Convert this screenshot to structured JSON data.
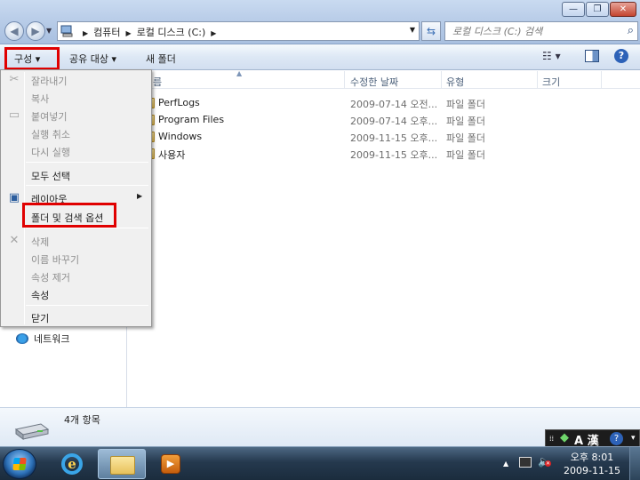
{
  "window": {
    "minimize_glyph": "—",
    "maximize_glyph": "❐",
    "close_glyph": "✕"
  },
  "address": {
    "crumbs": [
      "컴퓨터",
      "로컬 디스크 (C:)"
    ],
    "search_placeholder": "로컬 디스크 (C:) 검색"
  },
  "toolbar": {
    "organize_label": "구성 ▾",
    "share_label": "공유 대상 ▾",
    "new_folder_label": "새 폴더",
    "view_icon": "view-menu-icon",
    "help_icon": "help-icon",
    "help_glyph": "?"
  },
  "columns": {
    "name": "름",
    "date": "수정한 날짜",
    "type": "유형",
    "size": "크기"
  },
  "files": [
    {
      "name": "PerfLogs",
      "date": "2009-07-14 오전...",
      "type": "파일 폴더"
    },
    {
      "name": "Program Files",
      "date": "2009-07-14 오후...",
      "type": "파일 폴더"
    },
    {
      "name": "Windows",
      "date": "2009-11-15 오후...",
      "type": "파일 폴더"
    },
    {
      "name": "사용자",
      "date": "2009-11-15 오후...",
      "type": "파일 폴더"
    }
  ],
  "nav": {
    "network_label": "네트워크"
  },
  "organize_menu": {
    "cut": "잘라내기",
    "copy": "복사",
    "paste": "붙여넣기",
    "undo": "실행 취소",
    "redo": "다시 실행",
    "select_all": "모두 선택",
    "layout": "레이아웃",
    "folder_options": "폴더 및 검색 옵션",
    "delete": "삭제",
    "rename": "이름 바꾸기",
    "remove_props": "속성 제거",
    "properties": "속성",
    "close": "닫기"
  },
  "details": {
    "item_count": "4개 항목"
  },
  "langbar": {
    "ime_label": "A 漢",
    "help_glyph": "?"
  },
  "taskbar": {
    "time": "오후 8:01",
    "date": "2009-11-15"
  },
  "colors": {
    "highlight_red": "#e00000",
    "folder_yellow": "#e7c15b"
  }
}
